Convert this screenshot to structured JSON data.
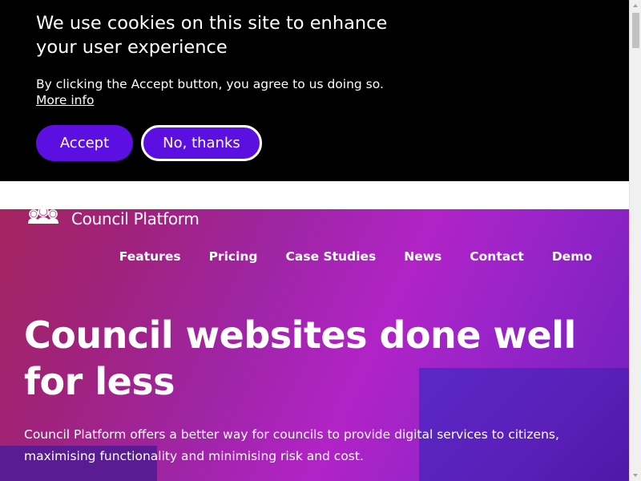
{
  "cookie_banner": {
    "title": "We use cookies on this site to enhance your user experience",
    "description": "By clicking the Accept button, you agree to us doing so.",
    "more_info_label": "More info",
    "accept_label": "Accept",
    "decline_label": "No, thanks"
  },
  "header": {
    "logo_text": "Council Platform",
    "logo_icon": "people-group-icon",
    "nav": [
      {
        "label": "Features"
      },
      {
        "label": "Pricing"
      },
      {
        "label": "Case Studies"
      },
      {
        "label": "News"
      },
      {
        "label": "Contact"
      },
      {
        "label": "Demo"
      }
    ]
  },
  "hero": {
    "title": "Council websites done well for less",
    "description": "Council Platform offers a better way for councils to provide digital services to citizens, maximising functionality and minimising risk and cost."
  },
  "colors": {
    "banner_bg": "#000000",
    "button_bg": "#5b0fe0",
    "hero_gradient_start": "#a4255f",
    "hero_gradient_end": "#6f1fbf"
  }
}
